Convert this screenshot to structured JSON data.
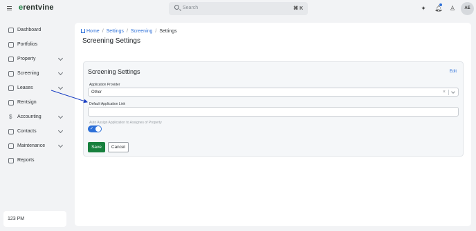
{
  "app": {
    "logo_prefix": "e",
    "logo_rest": "rentvine"
  },
  "topbar": {
    "search_placeholder": "Search",
    "search_shortcut": "⌘ K",
    "icons": [
      "sparkle-icon",
      "bell-icon",
      "user-icon"
    ],
    "avatar_initials": "AE"
  },
  "sidebar": {
    "items": [
      {
        "label": "Dashboard",
        "icon": "dashboard-icon",
        "has_chevron": false
      },
      {
        "label": "Portfolios",
        "icon": "portfolio-icon",
        "has_chevron": false
      },
      {
        "label": "Property",
        "icon": "property-icon",
        "has_chevron": true
      },
      {
        "label": "Screening",
        "icon": "screening-icon",
        "has_chevron": true
      },
      {
        "label": "Leases",
        "icon": "leases-icon",
        "has_chevron": true
      },
      {
        "label": "Rentsign",
        "icon": "rentsign-icon",
        "has_chevron": false
      },
      {
        "label": "Accounting",
        "icon": "dollar-icon",
        "has_chevron": true
      },
      {
        "label": "Contacts",
        "icon": "contacts-icon",
        "has_chevron": true
      },
      {
        "label": "Maintenance",
        "icon": "wrench-icon",
        "has_chevron": true
      },
      {
        "label": "Reports",
        "icon": "reports-icon",
        "has_chevron": false
      }
    ],
    "time": "123 PM"
  },
  "breadcrumb": {
    "items": [
      "Home",
      "Settings",
      "Screening",
      "Settings"
    ]
  },
  "page": {
    "title": "Screening Settings"
  },
  "card": {
    "title": "Screening Settings",
    "edit_label": "Edit",
    "provider_label": "Application Provider",
    "provider_value": "Other",
    "link_label": "Default Application Link",
    "link_value": "",
    "auto_assign_label": "Auto Assign Application to Assignes of Property",
    "auto_assign_enabled": true,
    "save_label": "Save",
    "cancel_label": "Cancel"
  },
  "colors": {
    "accent_blue": "#2c6fd8",
    "save_green": "#17803d",
    "arrow_blue": "#1a3fc4"
  }
}
